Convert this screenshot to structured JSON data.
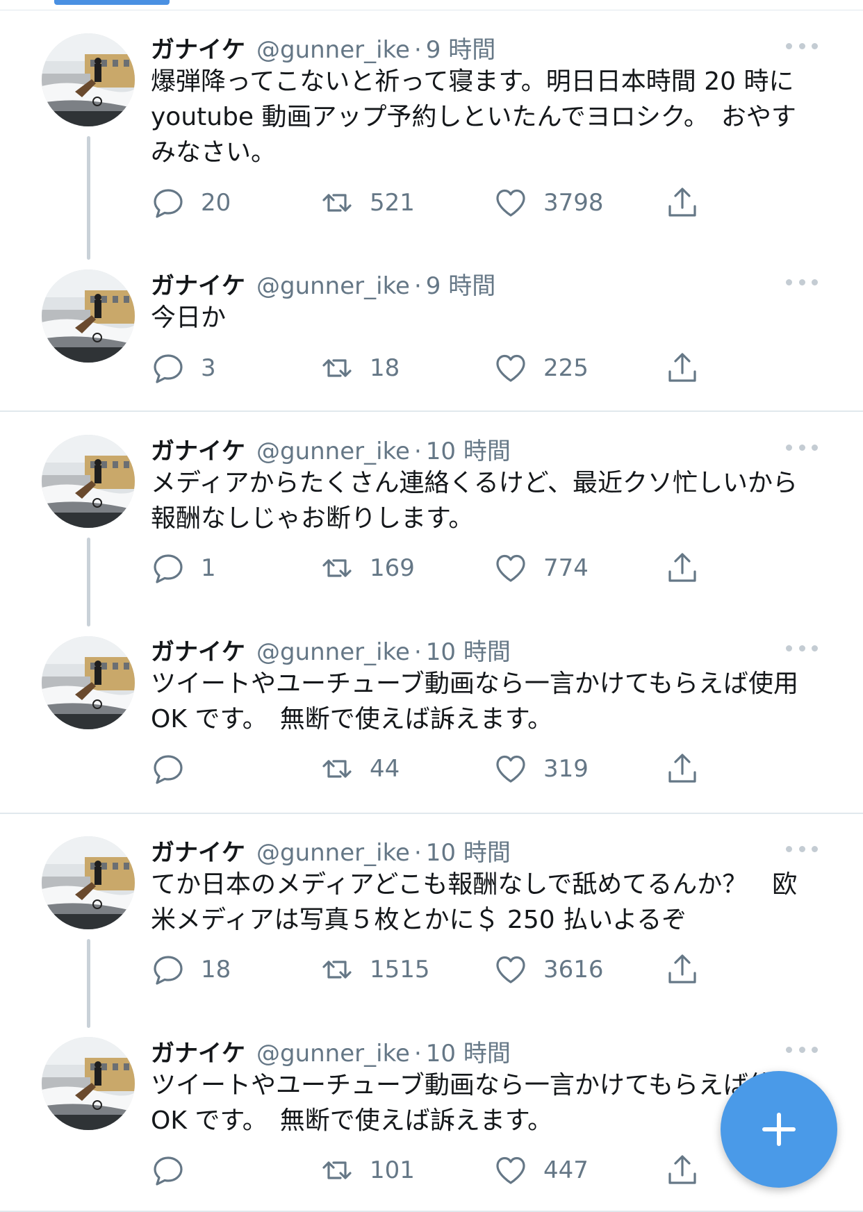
{
  "tweets": [
    {
      "name": "ガナイケ",
      "handle": "@gunner_ike",
      "time": "9 時間",
      "text": "爆弾降ってこないと祈って寝ます。明日日本時間 20 時に\nyoutube 動画アップ予約しといたんでヨロシク。　おやす\nみなさい。",
      "replies": "20",
      "retweets": "521",
      "likes": "3798"
    },
    {
      "name": "ガナイケ",
      "handle": "@gunner_ike",
      "time": "9 時間",
      "text": "今日か",
      "replies": "3",
      "retweets": "18",
      "likes": "225"
    },
    {
      "name": "ガナイケ",
      "handle": "@gunner_ike",
      "time": "10 時間",
      "text": "メディアからたくさん連絡くるけど、最近クソ忙しいから\n報酬なしじゃお断りします。",
      "replies": "1",
      "retweets": "169",
      "likes": "774"
    },
    {
      "name": "ガナイケ",
      "handle": "@gunner_ike",
      "time": "10 時間",
      "text": "ツイートやユーチューブ動画なら一言かけてもらえば使用\nOK です。　無断で使えば訴えます。",
      "replies": "",
      "retweets": "44",
      "likes": "319"
    },
    {
      "name": "ガナイケ",
      "handle": "@gunner_ike",
      "time": "10 時間",
      "text": "てか日本のメディアどこも報酬なしで舐めてるんか？　欧\n米メディアは写真５枚とかに＄ 250 払いよるぞ",
      "replies": "18",
      "retweets": "1515",
      "likes": "3616"
    },
    {
      "name": "ガナイケ",
      "handle": "@gunner_ike",
      "time": "10 時間",
      "text": "ツイートやユーチューブ動画なら一言かけてもらえば使用\nOK です。　無断で使えば訴えます。",
      "replies": "",
      "retweets": "101",
      "likes": "447"
    }
  ],
  "colors": {
    "accent": "#4a9ae8",
    "text": "#14171a",
    "secondary": "#657786",
    "divider": "#e1e8ed"
  },
  "icons": [
    "reply-icon",
    "retweet-icon",
    "like-icon",
    "share-icon",
    "more-icon",
    "compose-icon"
  ]
}
